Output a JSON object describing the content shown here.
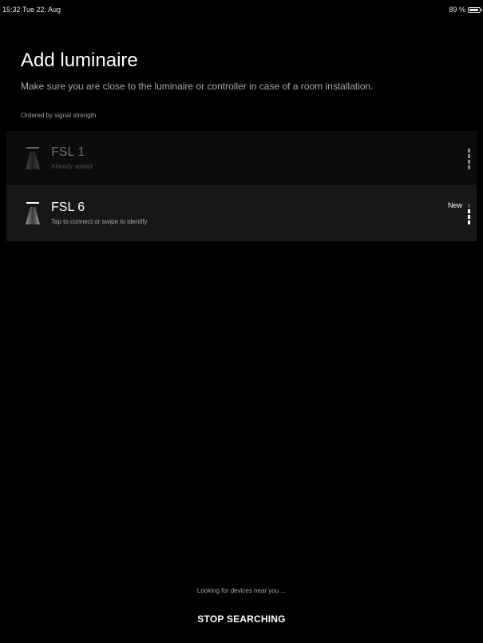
{
  "status_bar": {
    "time_date": "15:32  Tue 22. Aug",
    "battery_text": "89 %",
    "battery_level": 0.89,
    "battery_icon": "battery-icon"
  },
  "header": {
    "title": "Add luminaire",
    "subtitle": "Make sure you are close to the luminaire or controller in case of a room installation.",
    "order_label": "Ordered by signal strength"
  },
  "devices": [
    {
      "name": "FSL 1",
      "description": "Already added",
      "badge": "",
      "state": "added",
      "icon": "luminaire-icon",
      "signal_icon": "signal-strength-icon",
      "signal_bars_lit": 4
    },
    {
      "name": "FSL 6",
      "description": "Tap to connect or swipe to identify",
      "badge": "New",
      "state": "new",
      "icon": "luminaire-icon",
      "signal_icon": "signal-strength-icon",
      "signal_bars_lit": 3
    }
  ],
  "footer": {
    "searching_text": "Looking for devices near you ...",
    "stop_label": "STOP SEARCHING"
  },
  "colors": {
    "background": "#000000",
    "row_active": "#171717",
    "row_dim": "#0c0c0c",
    "text_secondary": "#a8a8a8"
  }
}
